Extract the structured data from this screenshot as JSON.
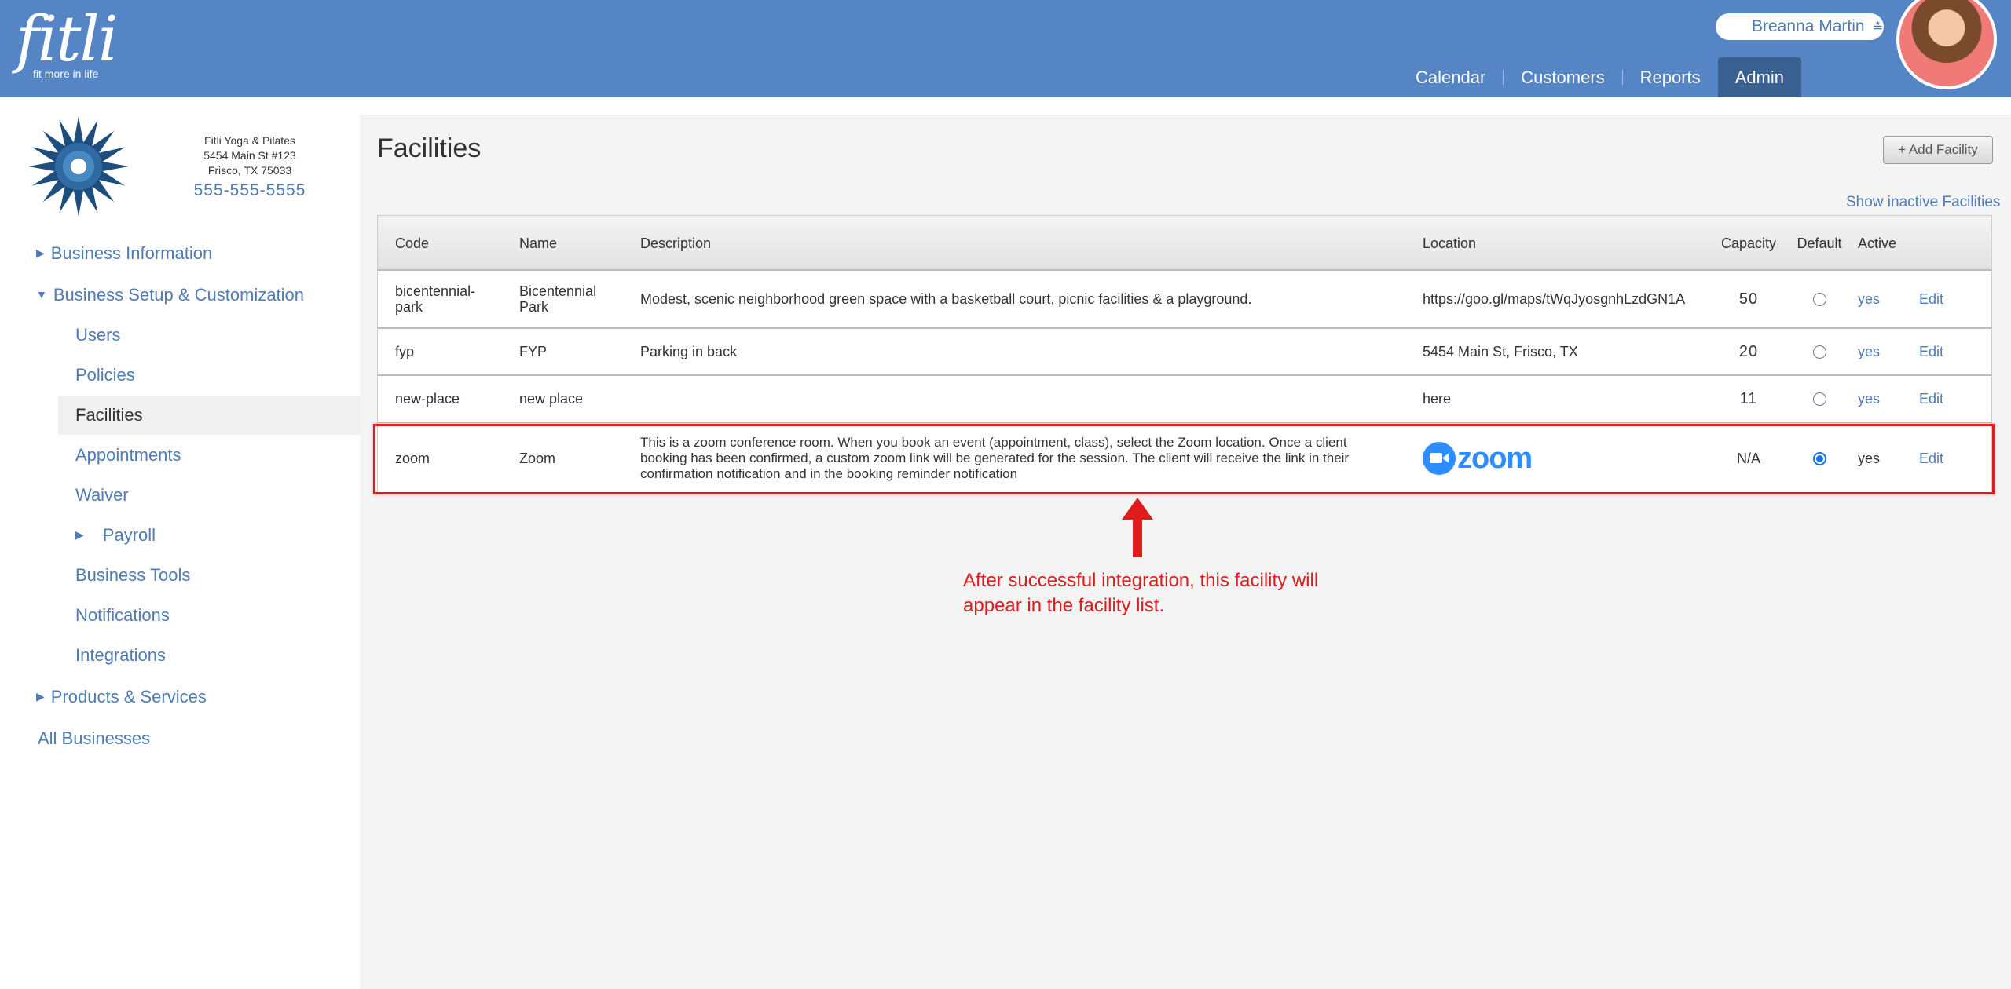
{
  "header": {
    "logo_text": "fitli",
    "logo_tagline": "fit more in life",
    "user_name": "Breanna Martin",
    "nav": [
      {
        "label": "Calendar"
      },
      {
        "label": "Customers"
      },
      {
        "label": "Reports"
      },
      {
        "label": "Admin",
        "active": true
      }
    ]
  },
  "business": {
    "name": "Fitli Yoga & Pilates",
    "address1": "5454 Main St #123",
    "address2": "Frisco, TX 75033",
    "phone": "555-555-5555"
  },
  "sidebar": {
    "business_information": "Business Information",
    "business_setup": "Business Setup & Customization",
    "users": "Users",
    "policies": "Policies",
    "facilities": "Facilities",
    "appointments": "Appointments",
    "waiver": "Waiver",
    "payroll": "Payroll",
    "business_tools": "Business Tools",
    "notifications": "Notifications",
    "integrations": "Integrations",
    "products_services": "Products & Services",
    "all_businesses": "All Businesses"
  },
  "main": {
    "title": "Facilities",
    "add_button": "+ Add Facility",
    "show_inactive": "Show inactive Facilities",
    "columns": {
      "code": "Code",
      "name": "Name",
      "description": "Description",
      "location": "Location",
      "capacity": "Capacity",
      "default": "Default",
      "active": "Active"
    },
    "rows": [
      {
        "code": "bicentennial-park",
        "name": "Bicentennial Park",
        "description": "Modest, scenic neighborhood green space with a basketball court, picnic facilities & a playground.",
        "location": "https://goo.gl/maps/tWqJyosgnhLzdGN1A",
        "capacity": "50",
        "is_default": false,
        "active": "yes",
        "edit": "Edit"
      },
      {
        "code": "fyp",
        "name": "FYP",
        "description": "Parking in back",
        "location": "5454 Main St, Frisco, TX",
        "capacity": "20",
        "is_default": false,
        "active": "yes",
        "edit": "Edit"
      },
      {
        "code": "new-place",
        "name": "new place",
        "description": "",
        "location": "here",
        "capacity": "11",
        "is_default": false,
        "active": "yes",
        "edit": "Edit"
      },
      {
        "code": "zoom",
        "name": "Zoom",
        "description": "This is a zoom conference room. When you book an event (appointment, class), select the Zoom location. Once a client booking has been confirmed, a custom zoom link will be generated for the session. The client will receive the link in their confirmation notification and in the booking reminder notification",
        "location_logo": "zoom",
        "capacity": "N/A",
        "is_default": true,
        "active": "yes",
        "edit": "Edit"
      }
    ]
  },
  "annotation": {
    "text": "After successful integration, this facility will appear in the facility list.",
    "color": "#e01b1b"
  },
  "colors": {
    "header_bg": "#5585c5",
    "nav_active_bg": "#3a5f91",
    "link": "#4f7bb6",
    "zoom_blue": "#2d8cff"
  }
}
